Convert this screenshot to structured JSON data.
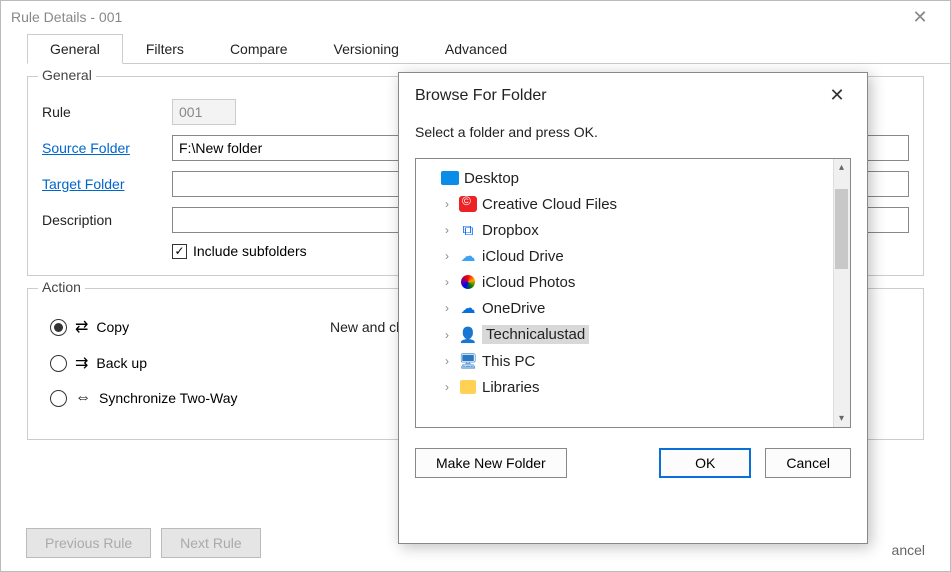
{
  "window": {
    "title": "Rule Details - 001",
    "close": "✕"
  },
  "tabs": [
    "General",
    "Filters",
    "Compare",
    "Versioning",
    "Advanced"
  ],
  "general": {
    "legend": "General",
    "rule_label": "Rule",
    "rule_value": "001",
    "source_label": "Source Folder",
    "source_value": "F:\\New folder",
    "target_label": "Target Folder",
    "target_value": "",
    "desc_label": "Description",
    "desc_value": "",
    "subfolders_label": "Include subfolders"
  },
  "action": {
    "legend": "Action",
    "copy": "Copy",
    "backup": "Back up",
    "sync": "Synchronize Two-Way",
    "static_text": "New and chan"
  },
  "footer": {
    "prev": "Previous Rule",
    "next": "Next Rule",
    "cancel_tail": "ancel"
  },
  "dialog": {
    "title": "Browse For Folder",
    "close": "✕",
    "sub": "Select a folder and press OK.",
    "items": [
      {
        "label": "Desktop",
        "icon": "desktop",
        "arrow": "",
        "indent": 0
      },
      {
        "label": "Creative Cloud Files",
        "icon": "cc",
        "arrow": ">",
        "indent": 1
      },
      {
        "label": "Dropbox",
        "icon": "dropbox",
        "arrow": ">",
        "indent": 1
      },
      {
        "label": "iCloud Drive",
        "icon": "icloud",
        "arrow": ">",
        "indent": 1
      },
      {
        "label": "iCloud Photos",
        "icon": "photos",
        "arrow": ">",
        "indent": 1
      },
      {
        "label": "OneDrive",
        "icon": "onedrive",
        "arrow": ">",
        "indent": 1
      },
      {
        "label": "Technicalustad",
        "icon": "user",
        "arrow": ">",
        "indent": 1,
        "selected": true
      },
      {
        "label": "This PC",
        "icon": "thispc",
        "arrow": ">",
        "indent": 1
      },
      {
        "label": "Libraries",
        "icon": "lib",
        "arrow": ">",
        "indent": 1
      }
    ],
    "make_folder": "Make New Folder",
    "ok": "OK",
    "cancel": "Cancel"
  }
}
